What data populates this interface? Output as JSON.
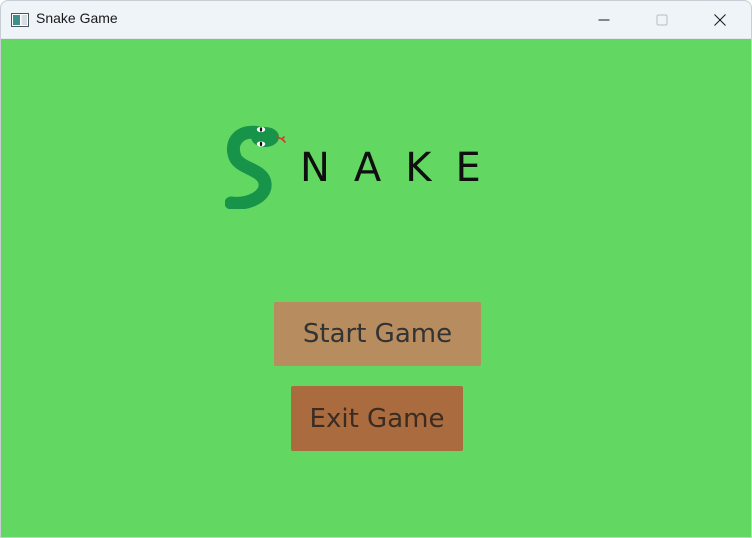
{
  "window": {
    "title": "Snake Game",
    "icon": "app-window-icon",
    "controls": [
      "minimize-icon",
      "maximize-icon",
      "close-icon"
    ]
  },
  "logo": {
    "icon": "snake-icon",
    "text": "NAKE"
  },
  "menu": {
    "start_label": "Start Game",
    "exit_label": "Exit Game"
  },
  "colors": {
    "background": "#62d762",
    "start_button": "#b78c5e",
    "exit_button": "#aa6b3e",
    "snake": "#18944a"
  }
}
